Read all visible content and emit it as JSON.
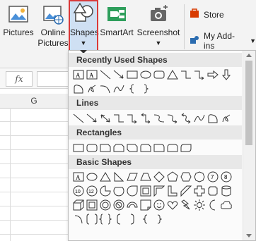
{
  "ribbon": {
    "buttons": [
      {
        "label": "Pictures",
        "icon": "pictures-icon"
      },
      {
        "label": "Online\nPictures",
        "label_line1": "Online",
        "label_line2": "Pictures",
        "icon": "online-pictures-icon"
      },
      {
        "label": "Shapes",
        "icon": "shapes-icon",
        "has_dropdown": true
      },
      {
        "label": "SmartArt",
        "icon": "smartart-icon"
      },
      {
        "label": "Screenshot",
        "icon": "screenshot-icon",
        "has_dropdown": true
      }
    ],
    "store_label": "Store",
    "addins_label": "My Add-ins"
  },
  "sheet": {
    "fx_label": "fx",
    "column_header": "G"
  },
  "shapes_menu": {
    "sections": [
      {
        "title": "Recently Used Shapes"
      },
      {
        "title": "Lines"
      },
      {
        "title": "Rectangles"
      },
      {
        "title": "Basic Shapes"
      }
    ]
  },
  "colors": {
    "selected_outline": "#d93a3a",
    "selected_fill": "#cfe0f3",
    "ribbon_bg": "#f3f3f3",
    "section_header_bg": "#e8e8e8",
    "store_icon": "#d83b01",
    "addins_icon": "#2b6cb0"
  }
}
